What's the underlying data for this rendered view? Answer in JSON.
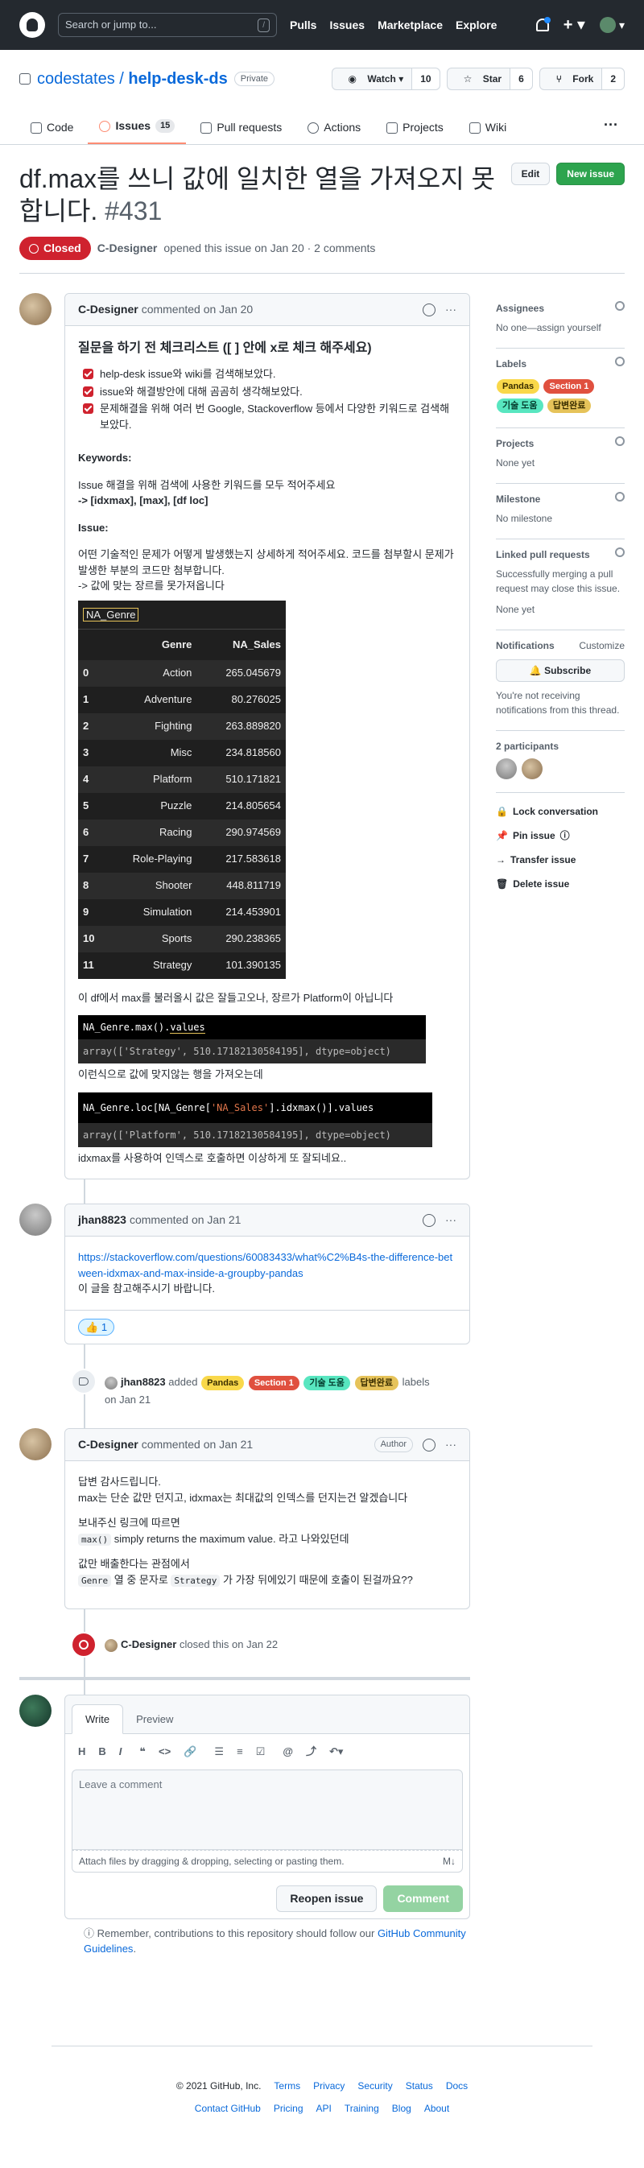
{
  "header": {
    "search_placeholder": "Search or jump to...",
    "slash": "/",
    "nav": [
      "Pulls",
      "Issues",
      "Marketplace",
      "Explore"
    ]
  },
  "repo": {
    "owner": "codestates",
    "name": "help-desk-ds",
    "visibility": "Private",
    "watch": "Watch",
    "watch_count": "10",
    "star": "Star",
    "star_count": "6",
    "fork": "Fork",
    "fork_count": "2",
    "tabs": [
      {
        "label": "Code",
        "icon": "code-icon"
      },
      {
        "label": "Issues",
        "count": "15",
        "icon": "issue-icon"
      },
      {
        "label": "Pull requests",
        "icon": "pr-icon"
      },
      {
        "label": "Actions",
        "icon": "play-icon"
      },
      {
        "label": "Projects",
        "icon": "table-icon"
      },
      {
        "label": "Wiki",
        "icon": "book-icon"
      }
    ]
  },
  "issue": {
    "title": "df.max를 쓰니 값에 일치한 열을 가져오지 못합니다.",
    "number": "#431",
    "edit": "Edit",
    "new_issue": "New issue",
    "state": "Closed",
    "author": "C-Designer",
    "meta": "opened this issue on Jan 20 · 2 comments"
  },
  "c1": {
    "author": "C-Designer",
    "when": "commented on Jan 20",
    "heading": "질문을 하기 전 체크리스트 ([ ] 안에 x로 체크 해주세요)",
    "checks": [
      "help-desk issue와 wiki를 검색해보았다.",
      "issue와 해결방안에 대해 곰곰히 생각해보았다.",
      "문제해결을 위해 여러 번 Google, Stackoverflow 등에서 다양한 키워드로 검색해 보았다."
    ],
    "kw_title": "Keywords:",
    "kw_desc": "Issue 해결을 위해 검색에 사용한 키워드를 모두 적어주세요",
    "kw_list": "-> [idxmax], [max], [df loc]",
    "is_title": "Issue:",
    "is_desc": "어떤 기술적인 문제가 어떻게 발생했는지 상세하게 적어주세요. 코드를 첨부할시 문제가 발생한 부분의 코드만 첨부합니다.",
    "is_arrow": "-> 값에 맞는 장르를 못가져옵니다",
    "df_name": "NA_Genre",
    "df_cols": [
      "Genre",
      "NA_Sales"
    ],
    "df_rows": [
      [
        "0",
        "Action",
        "265.045679"
      ],
      [
        "1",
        "Adventure",
        "80.276025"
      ],
      [
        "2",
        "Fighting",
        "263.889820"
      ],
      [
        "3",
        "Misc",
        "234.818560"
      ],
      [
        "4",
        "Platform",
        "510.171821"
      ],
      [
        "5",
        "Puzzle",
        "214.805654"
      ],
      [
        "6",
        "Racing",
        "290.974569"
      ],
      [
        "7",
        "Role-Playing",
        "217.583618"
      ],
      [
        "8",
        "Shooter",
        "448.811719"
      ],
      [
        "9",
        "Simulation",
        "214.453901"
      ],
      [
        "10",
        "Sports",
        "290.238365"
      ],
      [
        "11",
        "Strategy",
        "101.390135"
      ]
    ],
    "after_df": "이 df에서 max를 불러올시 값은 잘들고오나, 장르가 Platform이 아닙니다",
    "code1_a": "NA_Genre.max().",
    "code1_b": "values",
    "code1_out": "array(['Strategy', 510.17182130584195], dtype=object)",
    "mid": "이런식으로 값에 맞지않는 행을 가져오는데",
    "code2_a": "NA_Genre.loc[NA_Genre[",
    "code2_s": "'NA_Sales'",
    "code2_b": "].idxmax()].values",
    "code2_out": "array(['Platform', 510.17182130584195], dtype=object)",
    "end": "idxmax를 사용하여 인덱스로 호출하면 이상하게 또 잘되네요.."
  },
  "c2": {
    "author": "jhan8823",
    "when": "commented on Jan 21",
    "link": "https://stackoverflow.com/questions/60083433/what%C2%B4s-the-difference-between-idxmax-and-max-inside-a-groupby-pandas",
    "text": "이 글을 참고해주시기 바랍니다.",
    "reaction": "👍",
    "reaction_count": "1"
  },
  "label_event": {
    "actor": "jhan8823",
    "verb": "added",
    "labels": [
      {
        "name": "Pandas",
        "bg": "#f9d84a",
        "fg": "#3b2f00"
      },
      {
        "name": "Section 1",
        "bg": "#e0503f",
        "fg": "#ffffff"
      },
      {
        "name": "기술 도움",
        "bg": "#58e6c0",
        "fg": "#053d2e"
      },
      {
        "name": "답변완료",
        "bg": "#e6c35a",
        "fg": "#3b2f00"
      }
    ],
    "tail": "labels",
    "when": "on Jan 21"
  },
  "c3": {
    "author": "C-Designer",
    "when": "commented on Jan 21",
    "role": "Author",
    "l1": "답변 감사드립니다.",
    "l2": "max는 단순 값만 던지고, idxmax는 최대값의 인덱스를 던지는건 알겠습니다",
    "l3": "보내주신 링크에 따르면",
    "l4_code": "max()",
    "l4": "simply returns the maximum value. 라고 나와있던데",
    "l5": "값만 배출한다는 관점에서",
    "l6_code1": "Genre",
    "l6_mid": "열 중 문자로",
    "l6_code2": "Strategy",
    "l6_end": "가 가장 뒤에있기 때문에 호출이 된걸까요??"
  },
  "close_event": {
    "actor": "C-Designer",
    "text": "closed this on Jan 22"
  },
  "form": {
    "write": "Write",
    "preview": "Preview",
    "placeholder": "Leave a comment",
    "attach": "Attach files by dragging & dropping, selecting or pasting them.",
    "md": "M↓",
    "reopen": "Reopen issue",
    "comment": "Comment"
  },
  "remember": {
    "text": "Remember, contributions to this repository should follow our",
    "link": "GitHub Community Guidelines",
    "end": "."
  },
  "sidebar": {
    "assignees": "Assignees",
    "assignees_val": "No one—assign yourself",
    "labels": "Labels",
    "projects": "Projects",
    "projects_val": "None yet",
    "milestone": "Milestone",
    "milestone_val": "No milestone",
    "linked": "Linked pull requests",
    "linked_desc": "Successfully merging a pull request may close this issue.",
    "linked_val": "None yet",
    "notif": "Notifications",
    "customize": "Customize",
    "subscribe": "Subscribe",
    "notif_desc": "You're not receiving notifications from this thread.",
    "participants": "2 participants",
    "lock": "Lock conversation",
    "pin": "Pin issue",
    "transfer": "Transfer issue",
    "delete": "Delete issue"
  },
  "footer": {
    "copy": "© 2021 GitHub, Inc.",
    "row1": [
      "Terms",
      "Privacy",
      "Security",
      "Status",
      "Docs"
    ],
    "row2": [
      "Contact GitHub",
      "Pricing",
      "API",
      "Training",
      "Blog",
      "About"
    ]
  },
  "colors": {
    "closed": "#cf222e",
    "green": "#2da44e",
    "link": "#0969da"
  }
}
